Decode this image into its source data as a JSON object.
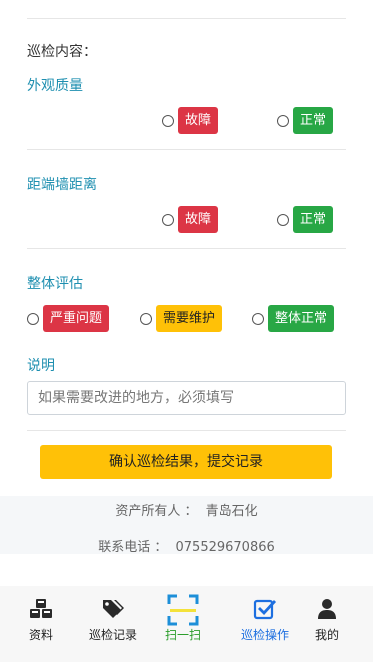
{
  "form": {
    "section_title": "巡检内容：",
    "items": [
      {
        "label": "外观质量",
        "options": [
          "故障",
          "正常"
        ]
      },
      {
        "label": "距端墙距离",
        "options": [
          "故障",
          "正常"
        ]
      },
      {
        "label": "整体评估",
        "options": [
          "严重问题",
          "需要维护",
          "整体正常"
        ]
      }
    ],
    "notes_label": "说明",
    "notes_placeholder": "如果需要改进的地方，必须填写",
    "submit_label": "确认巡检结果，提交记录"
  },
  "info": {
    "owner_label": "资产所有人 ：",
    "owner_value": "青岛石化",
    "phone_label": "联系电话 ：",
    "phone_value": "075529670866"
  },
  "tabbar": {
    "tabs": [
      {
        "label": "资料",
        "icon": "cubes-icon"
      },
      {
        "label": "巡检记录",
        "icon": "tags-icon"
      },
      {
        "label": "扫一扫",
        "icon": "scan-icon"
      },
      {
        "label": "巡检操作",
        "icon": "check-square-icon"
      },
      {
        "label": "我的",
        "icon": "user-icon"
      }
    ],
    "active_index": 3
  },
  "colors": {
    "accent_label": "#1e8fb0",
    "danger": "#dc3545",
    "success": "#28a745",
    "warning": "#ffc107",
    "active_tab": "#1d6fe0",
    "scan": "#2a9d2a"
  }
}
